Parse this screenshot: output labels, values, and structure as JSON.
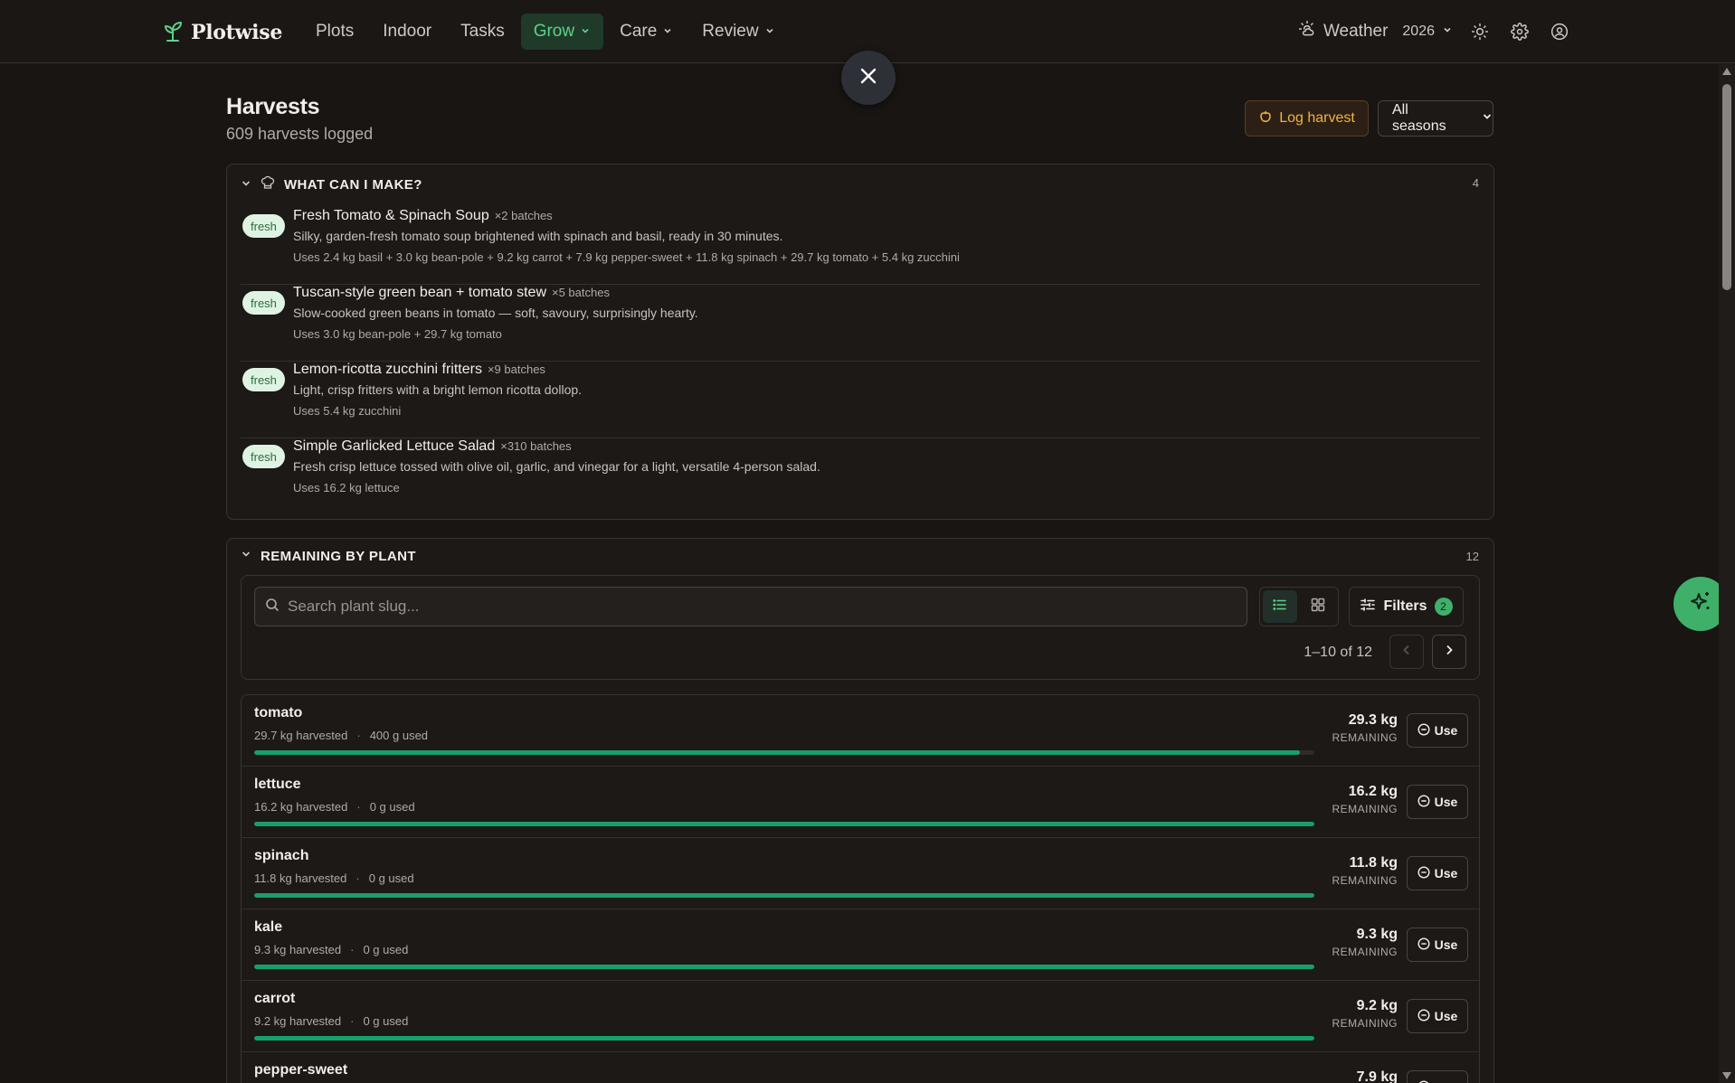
{
  "nav": {
    "brand": "Plotwise",
    "links": [
      {
        "label": "Plots",
        "dropdown": false,
        "active": false
      },
      {
        "label": "Indoor",
        "dropdown": false,
        "active": false
      },
      {
        "label": "Tasks",
        "dropdown": false,
        "active": false
      },
      {
        "label": "Grow",
        "dropdown": true,
        "active": true
      },
      {
        "label": "Care",
        "dropdown": true,
        "active": false
      },
      {
        "label": "Review",
        "dropdown": true,
        "active": false
      }
    ],
    "weather": "Weather",
    "year": "2026"
  },
  "header": {
    "title": "Harvests",
    "subtitle": "609 harvests logged",
    "log_button": "Log harvest",
    "season_select": "All seasons"
  },
  "make": {
    "title": "WHAT CAN I MAKE?",
    "count": "4",
    "recipes": [
      {
        "badge": "fresh",
        "name": "Fresh Tomato & Spinach Soup",
        "batches": "×2 batches",
        "desc": "Silky, garden-fresh tomato soup brightened with spinach and basil, ready in 30 minutes.",
        "uses": "Uses 2.4 kg basil + 3.0 kg bean-pole + 9.2 kg carrot + 7.9 kg pepper-sweet + 11.8 kg spinach + 29.7 kg tomato + 5.4 kg zucchini"
      },
      {
        "badge": "fresh",
        "name": "Tuscan-style green bean + tomato stew",
        "batches": "×5 batches",
        "desc": "Slow-cooked green beans in tomato — soft, savoury, surprisingly hearty.",
        "uses": "Uses 3.0 kg bean-pole + 29.7 kg tomato"
      },
      {
        "badge": "fresh",
        "name": "Lemon-ricotta zucchini fritters",
        "batches": "×9 batches",
        "desc": "Light, crisp fritters with a bright lemon ricotta dollop.",
        "uses": "Uses 5.4 kg zucchini"
      },
      {
        "badge": "fresh",
        "name": "Simple Garlicked Lettuce Salad",
        "batches": "×310 batches",
        "desc": "Fresh crisp lettuce tossed with olive oil, garlic, and vinegar for a light, versatile 4-person salad.",
        "uses": "Uses 16.2 kg lettuce"
      }
    ]
  },
  "remaining": {
    "title": "REMAINING BY PLANT",
    "count": "12",
    "search_placeholder": "Search plant slug...",
    "filters_label": "Filters",
    "filters_count": "2",
    "pager": "1–10 of 12",
    "remaining_label": "REMAINING",
    "use_label": "Use",
    "plants": [
      {
        "name": "tomato",
        "harvested": "29.7 kg harvested",
        "used": "400 g used",
        "remaining": "29.3 kg",
        "fraction": 0.9865
      },
      {
        "name": "lettuce",
        "harvested": "16.2 kg harvested",
        "used": "0 g used",
        "remaining": "16.2 kg",
        "fraction": 1.0
      },
      {
        "name": "spinach",
        "harvested": "11.8 kg harvested",
        "used": "0 g used",
        "remaining": "11.8 kg",
        "fraction": 1.0
      },
      {
        "name": "kale",
        "harvested": "9.3 kg harvested",
        "used": "0 g used",
        "remaining": "9.3 kg",
        "fraction": 1.0
      },
      {
        "name": "carrot",
        "harvested": "9.2 kg harvested",
        "used": "0 g used",
        "remaining": "9.2 kg",
        "fraction": 1.0
      },
      {
        "name": "pepper-sweet",
        "harvested": "",
        "used": "",
        "remaining": "7.9 kg",
        "fraction": 1.0
      }
    ]
  },
  "colors": {
    "accent_green": "#3fb06a",
    "bar_green": "#18a06a",
    "log_orange": "#f0b340"
  }
}
